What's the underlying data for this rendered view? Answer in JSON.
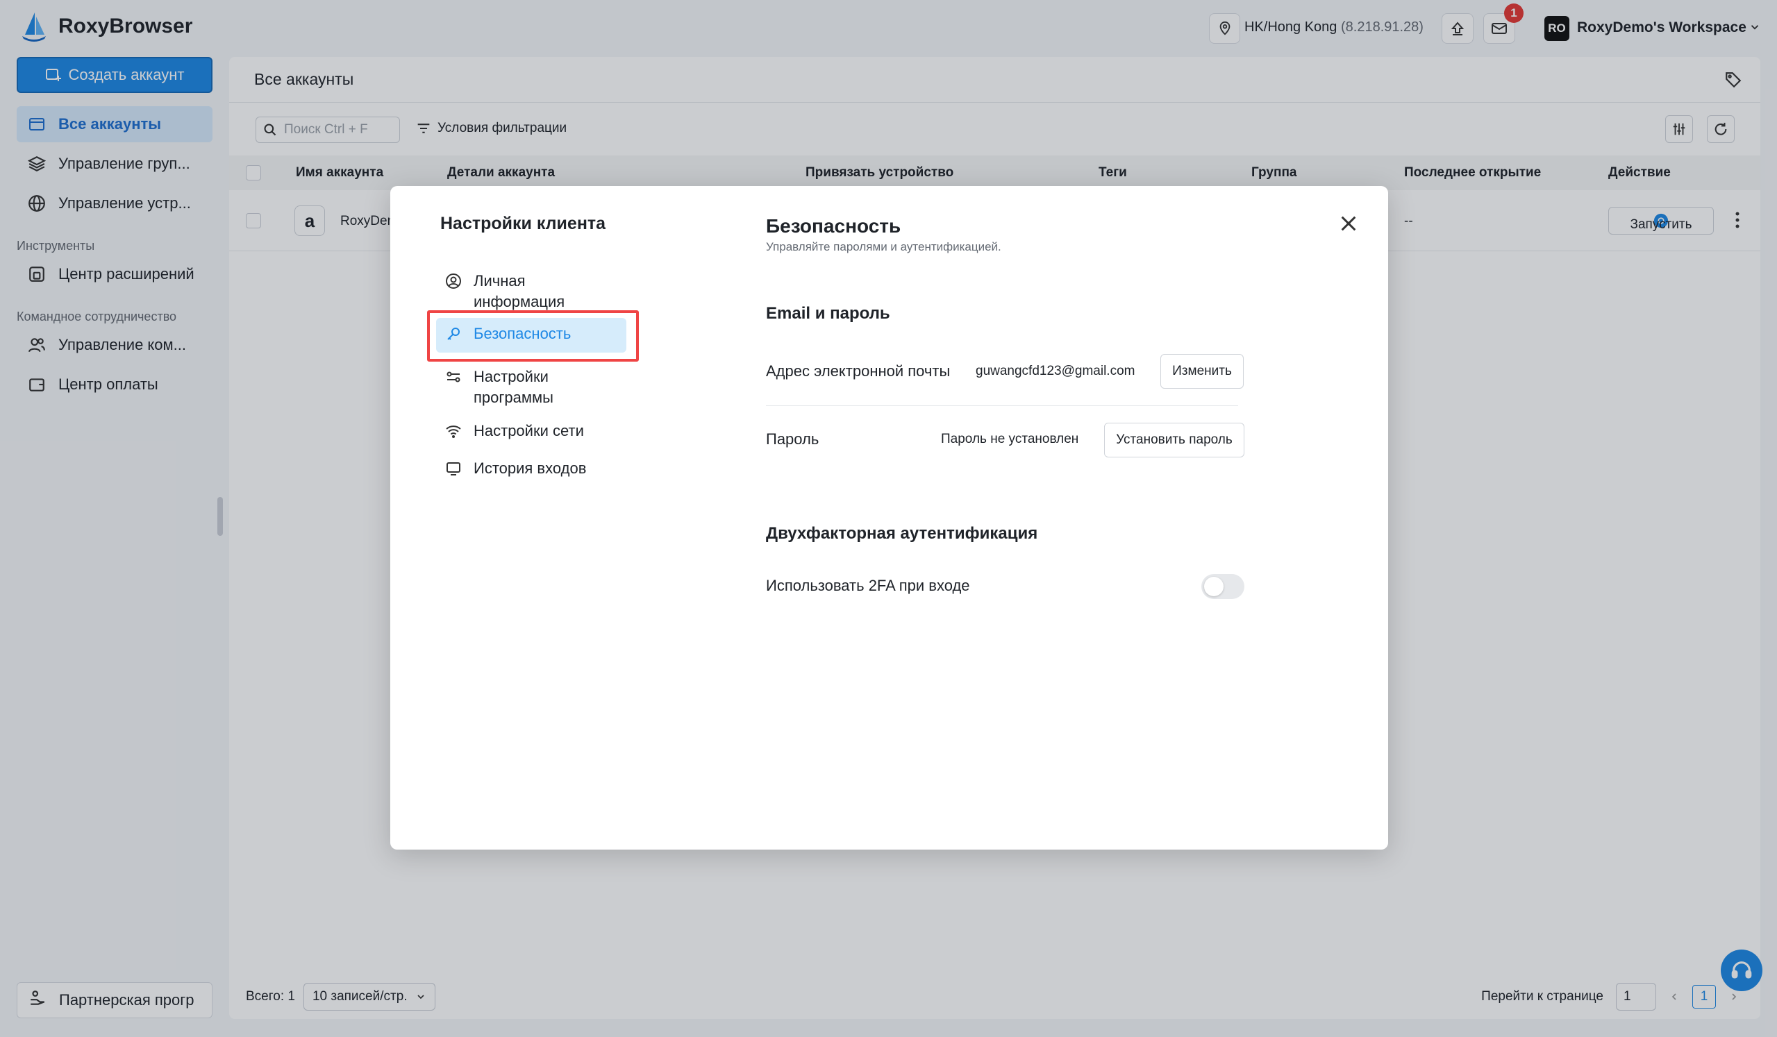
{
  "app": {
    "name": "RoxyBrowser"
  },
  "topbar": {
    "location": "HK/Hong Kong",
    "ip": "(8.218.91.28)",
    "notification_count": "1",
    "workspace_initials": "RO",
    "workspace_name": "RoxyDemo's Workspace"
  },
  "sidebar": {
    "create_label": "Создать аккаунт",
    "items": [
      {
        "label": "Все аккаунты"
      },
      {
        "label": "Управление груп..."
      },
      {
        "label": "Управление устр..."
      }
    ],
    "tools_section": "Инструменты",
    "tools_items": [
      {
        "label": "Центр расширений"
      }
    ],
    "team_section": "Командное сотрудничество",
    "team_items": [
      {
        "label": "Управление ком..."
      },
      {
        "label": "Центр оплаты"
      }
    ],
    "partner_label": "Партнерская прогр"
  },
  "main": {
    "title": "Все аккаунты",
    "search_placeholder": "Поиск Ctrl + F",
    "filter_label": "Условия фильтрации",
    "columns": [
      "Имя аккаунта",
      "Детали аккаунта",
      "Привязать устройство",
      "Теги",
      "Группа",
      "Последнее открытие",
      "Действие"
    ],
    "row": {
      "name": "RoxyDen",
      "last_open": "--",
      "launch_label": "Запустить",
      "amz_letter": "a"
    },
    "footer": {
      "total": "Всего: 1",
      "page_size": "10 записей/стр.",
      "goto_label": "Перейти к странице",
      "goto_value": "1",
      "current_page": "1"
    }
  },
  "modal": {
    "title": "Настройки клиента",
    "nav": [
      {
        "label": "Личная информация"
      },
      {
        "label": "Безопасность"
      },
      {
        "label": "Настройки программы"
      },
      {
        "label": "Настройки сети"
      },
      {
        "label": "История входов"
      }
    ],
    "section_title": "Безопасность",
    "section_subtitle": "Управляйте паролями и аутентификацией.",
    "email_group": "Email и пароль",
    "email_label": "Адрес электронной почты",
    "email_value": "guwangcfd123@gmail.com",
    "change_label": "Изменить",
    "password_label": "Пароль",
    "password_value": "Пароль не установлен",
    "set_password_label": "Установить пароль",
    "twofa_group": "Двухфакторная аутентификация",
    "twofa_label": "Использовать 2FA при входе",
    "twofa_enabled": false
  },
  "colors": {
    "accent": "#1e88e5",
    "highlight": "#ef4444"
  }
}
